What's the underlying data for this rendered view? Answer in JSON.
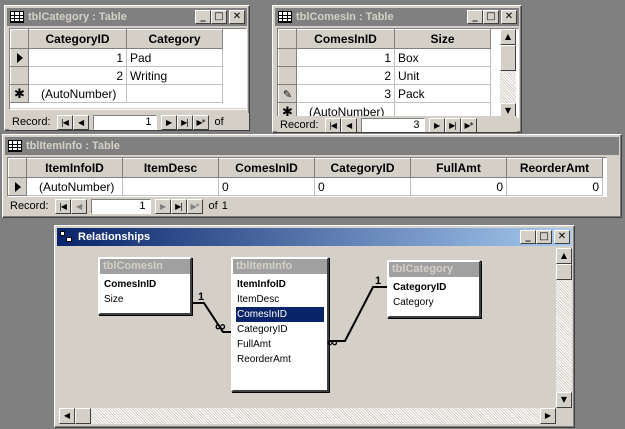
{
  "category_window": {
    "title": "tblCategory : Table",
    "columns": [
      "CategoryID",
      "Category"
    ],
    "rows": [
      {
        "marker": "current",
        "id": "1",
        "value": "Pad"
      },
      {
        "marker": "",
        "id": "2",
        "value": "Writing"
      },
      {
        "marker": "new",
        "id": "(AutoNumber)",
        "value": ""
      }
    ],
    "nav": {
      "label": "Record:",
      "current": "1",
      "of": "of"
    }
  },
  "comesin_window": {
    "title": "tblComesIn : Table",
    "columns": [
      "ComesInID",
      "Size"
    ],
    "rows": [
      {
        "marker": "",
        "id": "1",
        "value": "Box"
      },
      {
        "marker": "",
        "id": "2",
        "value": "Unit"
      },
      {
        "marker": "editing",
        "id": "3",
        "value": "Pack"
      },
      {
        "marker": "new",
        "id": "(AutoNumber)",
        "value": ""
      }
    ],
    "nav": {
      "label": "Record:",
      "current": "3"
    }
  },
  "iteminfo_window": {
    "title": "tblItemInfo : Table",
    "columns": [
      "ItemInfoID",
      "ItemDesc",
      "ComesInID",
      "CategoryID",
      "FullAmt",
      "ReorderAmt"
    ],
    "row": {
      "ItemInfoID": "(AutoNumber)",
      "ItemDesc": "",
      "ComesInID": "0",
      "CategoryID": "0",
      "FullAmt": "0",
      "ReorderAmt": "0"
    },
    "nav": {
      "label": "Record:",
      "current": "1",
      "of": "of",
      "total": "1"
    }
  },
  "relationships_window": {
    "title": "Relationships",
    "tables": {
      "comesin": {
        "name": "tblComesIn",
        "fields": [
          "ComesInID",
          "Size"
        ]
      },
      "iteminfo": {
        "name": "tblItemInfo",
        "fields": [
          "ItemInfoID",
          "ItemDesc",
          "ComesInID",
          "CategoryID",
          "FullAmt",
          "ReorderAmt"
        ],
        "selected": "ComesInID"
      },
      "category": {
        "name": "tblCategory",
        "fields": [
          "CategoryID",
          "Category"
        ]
      }
    },
    "links": [
      {
        "one": "1",
        "many": "∞"
      },
      {
        "one": "1",
        "many": "∞"
      }
    ]
  },
  "title_buttons": {
    "minimize": "_",
    "maximize": "□",
    "close": "✕"
  },
  "nav_glyphs": {
    "first": "|◀",
    "prev": "◀",
    "next": "▶",
    "last": "▶|",
    "new": "▶*"
  }
}
